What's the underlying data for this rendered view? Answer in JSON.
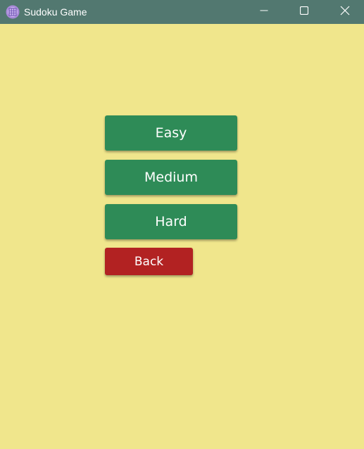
{
  "window": {
    "title": "Sudoku Game",
    "app_icon": "sudoku-grid-icon",
    "controls": {
      "minimize_icon": "minimize-icon",
      "maximize_icon": "maximize-icon",
      "close_icon": "close-icon"
    }
  },
  "menu": {
    "easy_label": "Easy",
    "medium_label": "Medium",
    "hard_label": "Hard",
    "back_label": "Back"
  },
  "colors": {
    "background": "#F0E68C",
    "titlebar": "#527870",
    "level_button": "#2E8B57",
    "back_button": "#B22222"
  }
}
